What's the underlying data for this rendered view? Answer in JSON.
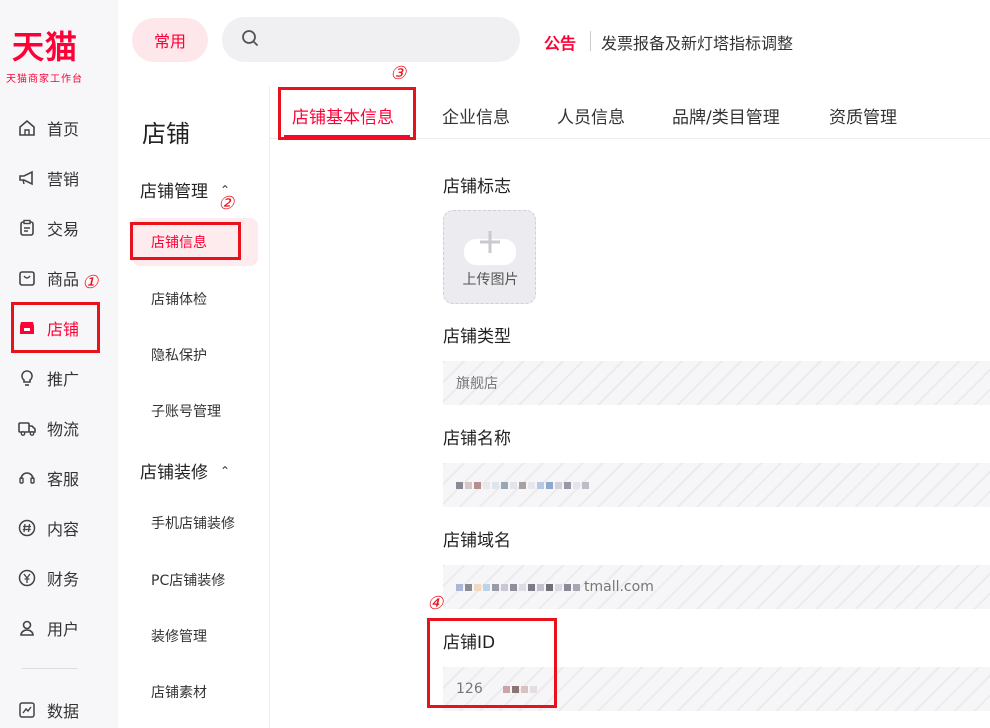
{
  "brand": {
    "name": "天猫",
    "subtitle": "天猫商家工作台"
  },
  "leftnav": {
    "items": [
      {
        "label": "首页",
        "icon": "home-icon"
      },
      {
        "label": "营销",
        "icon": "megaphone-icon"
      },
      {
        "label": "交易",
        "icon": "clipboard-icon"
      },
      {
        "label": "商品",
        "icon": "bag-icon"
      },
      {
        "label": "店铺",
        "icon": "store-icon",
        "active": true
      },
      {
        "label": "推广",
        "icon": "lightbulb-icon"
      },
      {
        "label": "物流",
        "icon": "truck-icon"
      },
      {
        "label": "客服",
        "icon": "headset-icon"
      },
      {
        "label": "内容",
        "icon": "hash-icon"
      },
      {
        "label": "财务",
        "icon": "yen-icon"
      },
      {
        "label": "用户",
        "icon": "user-icon"
      },
      {
        "label": "数据",
        "icon": "chart-icon"
      }
    ]
  },
  "topbar": {
    "common_label": "常用",
    "search_placeholder": "",
    "notice_label": "公告",
    "notice_text": "发票报备及新灯塔指标调整"
  },
  "subnav": {
    "title": "店铺",
    "groups": [
      {
        "title": "店铺管理",
        "items": [
          "店铺信息",
          "店铺体检",
          "隐私保护",
          "子账号管理"
        ]
      },
      {
        "title": "店铺装修",
        "items": [
          "手机店铺装修",
          "PC店铺装修",
          "装修管理",
          "店铺素材"
        ]
      }
    ]
  },
  "tabs": [
    "店铺基本信息",
    "企业信息",
    "人员信息",
    "品牌/类目管理",
    "资质管理"
  ],
  "form": {
    "logo_label": "店铺标志",
    "upload_text": "上传图片",
    "type_label": "店铺类型",
    "type_value": "旗舰店",
    "name_label": "店铺名称",
    "domain_label": "店铺域名",
    "domain_value": "tmall.com",
    "id_label": "店铺ID",
    "id_value": "126"
  },
  "annotations": [
    "①",
    "②",
    "③",
    "④"
  ],
  "colors": {
    "accent": "#ff0036",
    "annotation": "#e8121d"
  }
}
